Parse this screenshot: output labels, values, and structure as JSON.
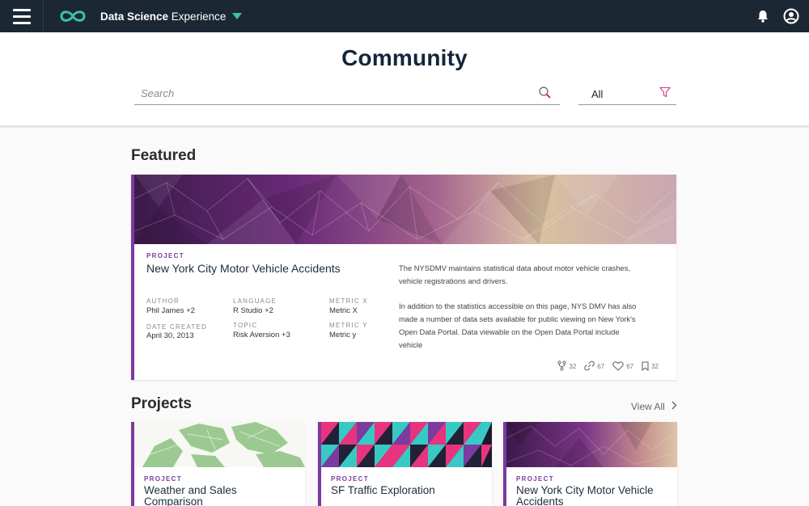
{
  "topbar": {
    "app_name_bold": "Data Science",
    "app_name_rest": " Experience",
    "icons": [
      "menu-icon",
      "infinity-logo-icon",
      "caret-down-icon",
      "bell-icon",
      "user-icon"
    ],
    "accent_color": "#3ebfaa",
    "bar_color": "#1b2834"
  },
  "header": {
    "title": "Community",
    "search_placeholder": "Search",
    "filter_value": "All"
  },
  "featured": {
    "section_title": "Featured",
    "card": {
      "tag": "PROJECT",
      "title": "New York City Motor Vehicle Accidents",
      "author_label": "AUTHOR",
      "author": "Phil James +2",
      "language_label": "LANGUAGE",
      "language": "R Studio +2",
      "metric_x_label": "METRIC X",
      "metric_x": "Metric X",
      "date_label": "DATE CREATED",
      "date": "April 30, 2013",
      "topic_label": "TOPIC",
      "topic": "Risk Aversion +3",
      "metric_y_label": "METRIC Y",
      "metric_y": "Metric y",
      "description_1": "The NYSDMV maintains statistical data about motor vehicle crashes, vehicle registrations and drivers.",
      "description_2": "In addition to the statistics accessible on this page, NYS DMV has also made a number of data sets available for public viewing on New York's Open Data Portal. Data viewable on the Open Data Portal include vehicle",
      "stats": {
        "forks": "32",
        "links": "67",
        "likes": "67",
        "bookmarks": "32"
      }
    }
  },
  "projects": {
    "section_title": "Projects",
    "view_all": "View All",
    "items": [
      {
        "tag": "PROJECT",
        "title": "Weather and Sales Comparison"
      },
      {
        "tag": "PROJECT",
        "title": "SF Traffic Exploration"
      },
      {
        "tag": "PROJECT",
        "title": "New York City Motor Vehicle Accidents"
      }
    ]
  },
  "colors": {
    "accent_purple": "#7b3ba0",
    "filter_pink": "#d9338a"
  }
}
